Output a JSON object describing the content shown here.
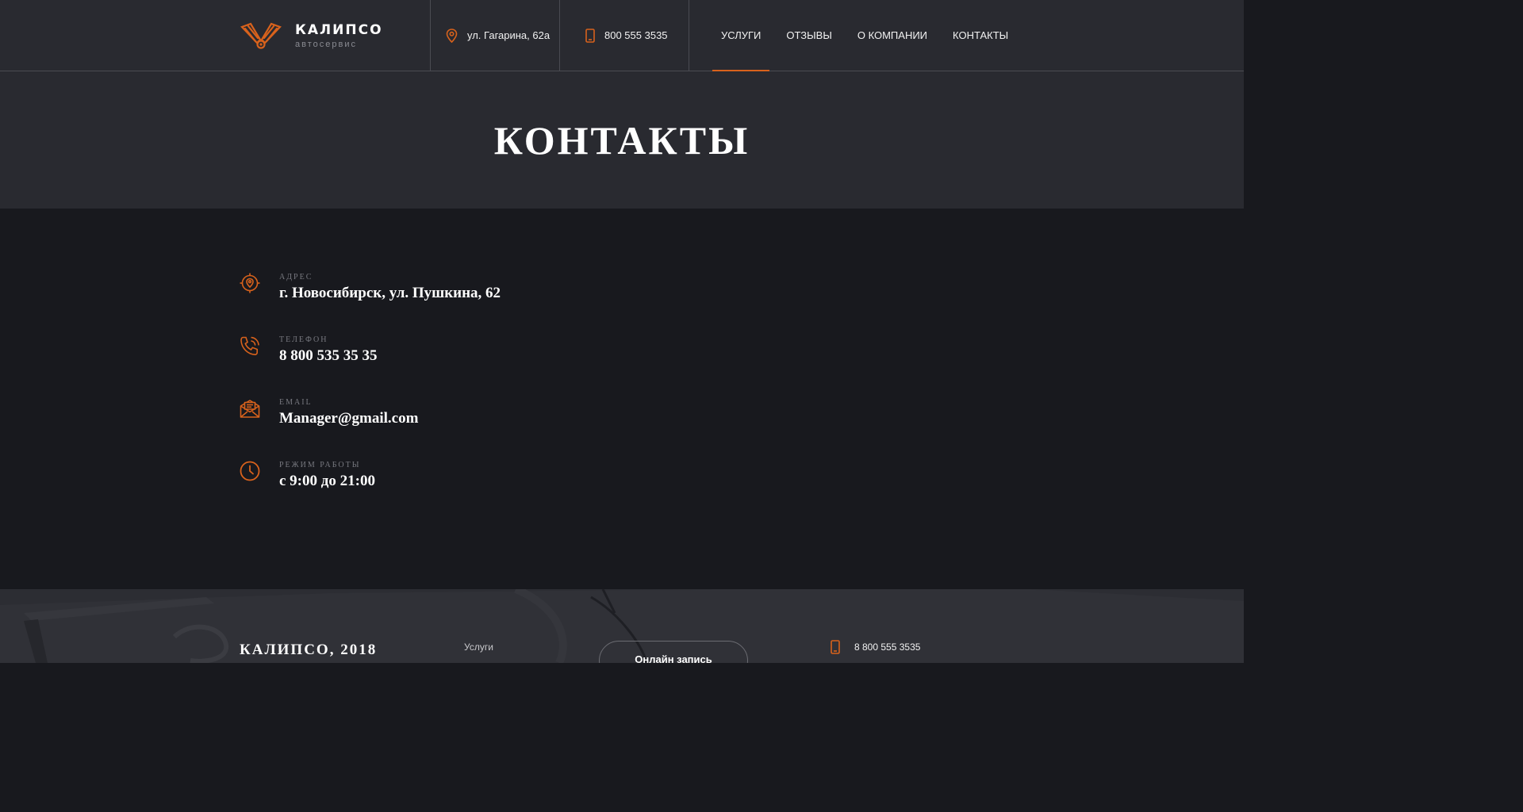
{
  "colors": {
    "accent": "#d8621c",
    "header_bg": "#292a30",
    "body_bg": "#18191e",
    "footer_bg": "#2c2d33"
  },
  "header": {
    "logo": {
      "name": "КАЛИПСО",
      "subtitle": "автосервис",
      "icon": "engine-pistons-logo-icon"
    },
    "address": {
      "icon": "location-pin-icon",
      "text": "ул. Гагарина, 62а"
    },
    "phone": {
      "icon": "smartphone-icon",
      "text": "800 555 3535"
    },
    "nav": [
      {
        "label": "УСЛУГИ",
        "active": true
      },
      {
        "label": "ОТЗЫВЫ",
        "active": false
      },
      {
        "label": "О КОМПАНИИ",
        "active": false
      },
      {
        "label": "КОНТАКТЫ",
        "active": false
      }
    ]
  },
  "page": {
    "title": "КОНТАКТЫ"
  },
  "contacts": [
    {
      "icon": "location-target-icon",
      "label": "АДРЕС",
      "value": "г. Новосибирск, ул. Пушкина, 62"
    },
    {
      "icon": "phone-ringing-icon",
      "label": "ТЕЛЕФОН",
      "value": "8 800 535 35 35"
    },
    {
      "icon": "envelope-icon",
      "label": "EMAIL",
      "value": "Manager@gmail.com"
    },
    {
      "icon": "clock-icon",
      "label": "РЕЖИМ РАБОТЫ",
      "value": "с 9:00 до 21:00"
    }
  ],
  "footer": {
    "brand": "КАЛИПСО, 2018",
    "link": "Услуги",
    "button": "Онлайн запись",
    "phone": {
      "icon": "smartphone-icon",
      "text": "8 800 555 3535"
    }
  }
}
